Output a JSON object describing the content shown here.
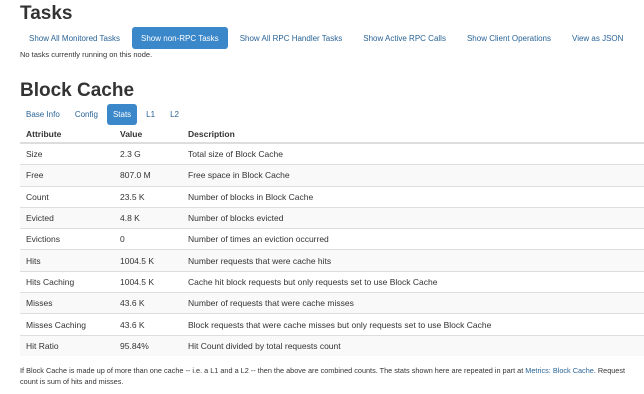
{
  "tasks": {
    "title": "Tasks",
    "tabs": [
      {
        "label": "Show All Monitored Tasks",
        "active": false
      },
      {
        "label": "Show non-RPC Tasks",
        "active": true
      },
      {
        "label": "Show All RPC Handler Tasks",
        "active": false
      },
      {
        "label": "Show Active RPC Calls",
        "active": false
      },
      {
        "label": "Show Client Operations",
        "active": false
      },
      {
        "label": "View as JSON",
        "active": false
      }
    ],
    "empty_message": "No tasks currently running on this node."
  },
  "block_cache": {
    "title": "Block Cache",
    "tabs": [
      {
        "label": "Base Info",
        "active": false
      },
      {
        "label": "Config",
        "active": false
      },
      {
        "label": "Stats",
        "active": true
      },
      {
        "label": "L1",
        "active": false
      },
      {
        "label": "L2",
        "active": false
      }
    ],
    "table": {
      "headers": [
        "Attribute",
        "Value",
        "Description"
      ],
      "rows": [
        [
          "Size",
          "2.3 G",
          "Total size of Block Cache"
        ],
        [
          "Free",
          "807.0 M",
          "Free space in Block Cache"
        ],
        [
          "Count",
          "23.5 K",
          "Number of blocks in Block Cache"
        ],
        [
          "Evicted",
          "4.8 K",
          "Number of blocks evicted"
        ],
        [
          "Evictions",
          "0",
          "Number of times an eviction occurred"
        ],
        [
          "Hits",
          "1004.5 K",
          "Number requests that were cache hits"
        ],
        [
          "Hits Caching",
          "1004.5 K",
          "Cache hit block requests but only requests set to use Block Cache"
        ],
        [
          "Misses",
          "43.6 K",
          "Number of requests that were cache misses"
        ],
        [
          "Misses Caching",
          "43.6 K",
          "Block requests that were cache misses but only requests set to use Block Cache"
        ],
        [
          "Hit Ratio",
          "95.84%",
          "Hit Count divided by total requests count"
        ]
      ]
    },
    "footer": {
      "text_before": "If Block Cache is made up of more than one cache -- i.e. a L1 and a L2 -- then the above are combined counts. The stats shown here are repeated in part at ",
      "link_label": "Metrics: Block Cache",
      "text_after": ". Request count is sum of hits and misses."
    }
  }
}
